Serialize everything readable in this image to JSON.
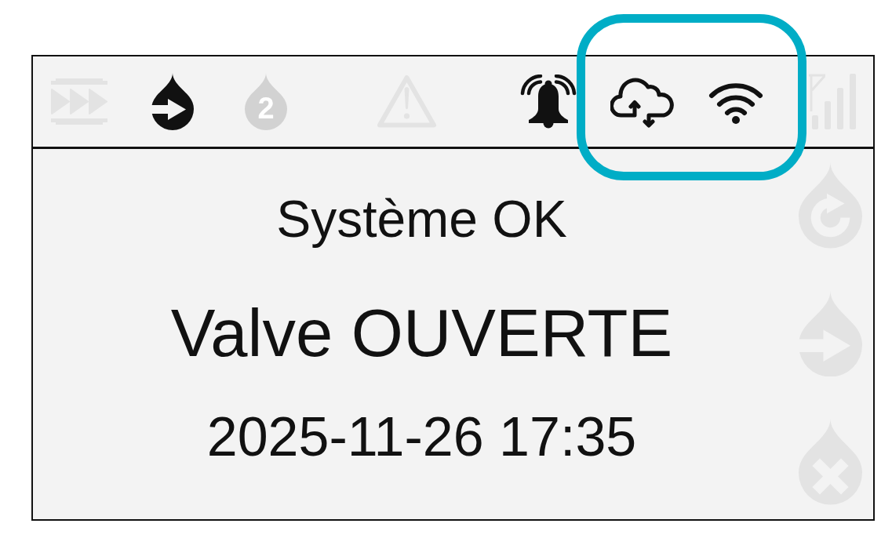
{
  "status_bar": {
    "icons": [
      {
        "kind": "fast-forward",
        "active": false,
        "highlighted": false
      },
      {
        "kind": "drop-arrow",
        "active": true,
        "highlighted": false
      },
      {
        "kind": "drop-number",
        "label": "2",
        "active": false,
        "highlighted": false
      },
      {
        "kind": "warning",
        "active": false,
        "highlighted": false
      },
      {
        "kind": "bell",
        "active": true,
        "highlighted": false
      },
      {
        "kind": "cloud-sync",
        "active": true,
        "highlighted": true
      },
      {
        "kind": "wifi",
        "active": true,
        "highlighted": true
      },
      {
        "kind": "signal",
        "active": false,
        "highlighted": false
      }
    ]
  },
  "display": {
    "lines": [
      {
        "kind": "status",
        "text": "Système OK"
      },
      {
        "kind": "valve",
        "text": "Valve OUVERTE"
      },
      {
        "kind": "datetime",
        "text": "2025-11-26 17:35"
      }
    ]
  },
  "side_icons": [
    {
      "kind": "drop-refresh",
      "active": false
    },
    {
      "kind": "drop-arrow",
      "active": false
    },
    {
      "kind": "drop-cross",
      "active": false
    }
  ]
}
